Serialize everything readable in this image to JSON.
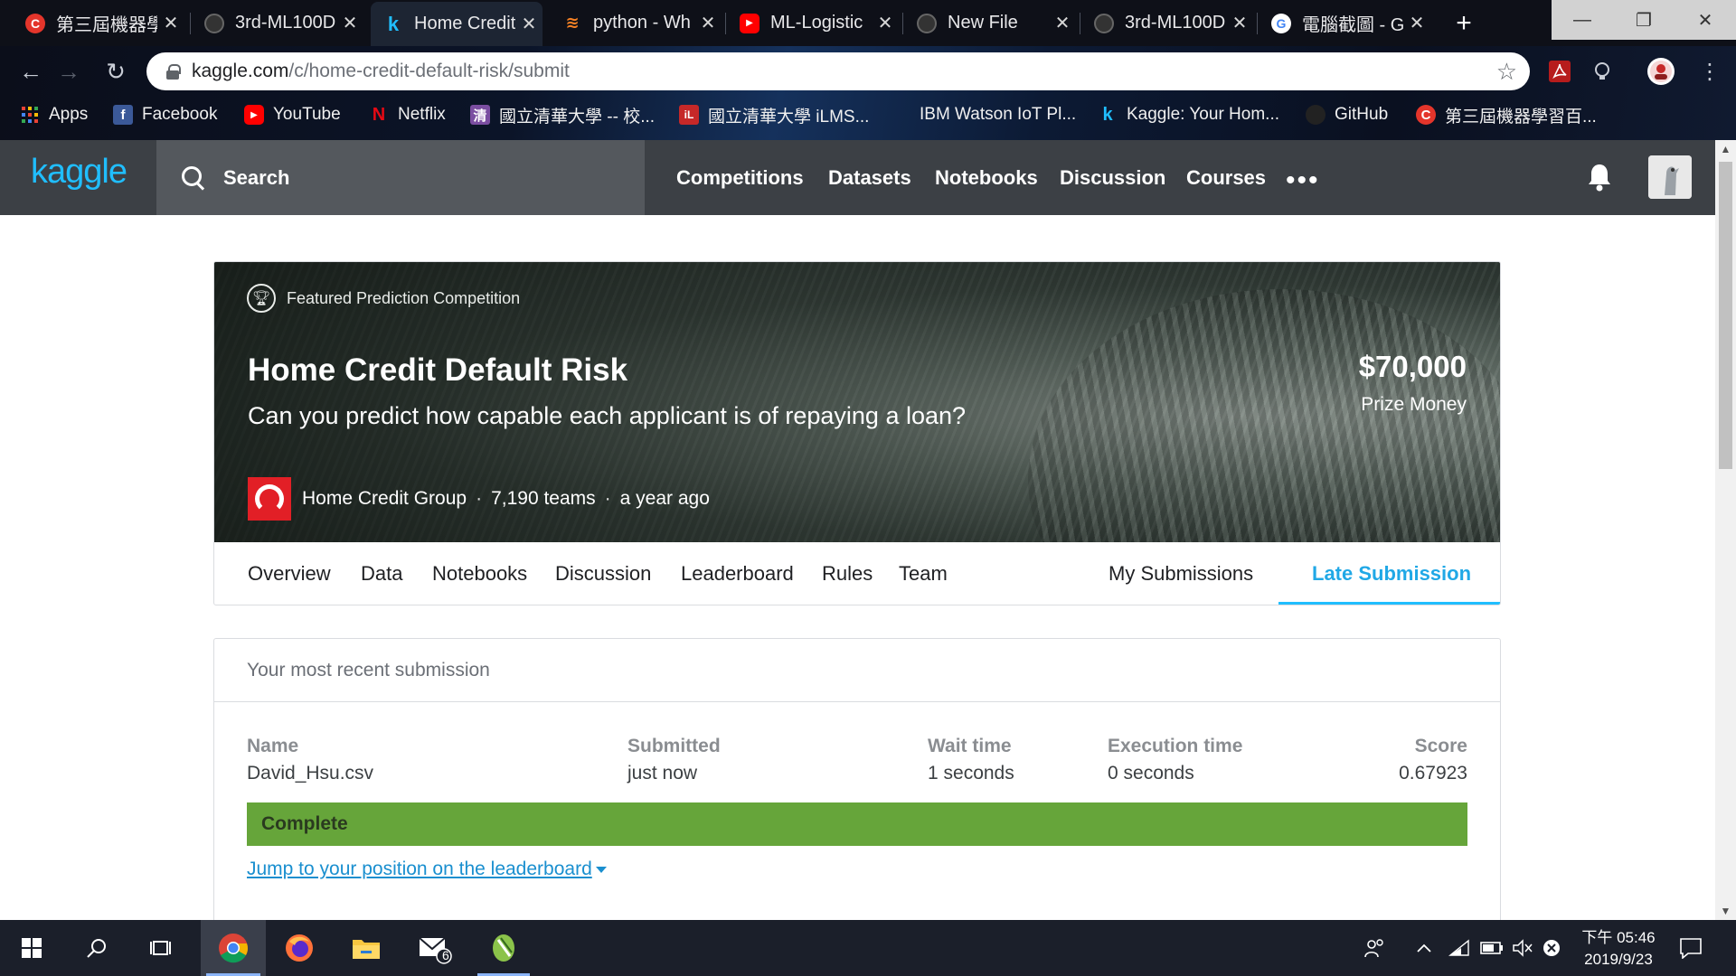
{
  "browser": {
    "tabs": [
      {
        "title": "第三屆機器學",
        "icon": "ml100-red-icon",
        "active": false
      },
      {
        "title": "3rd-ML100D",
        "icon": "github-icon",
        "active": false
      },
      {
        "title": "Home Credit",
        "icon": "kaggle-icon",
        "active": true
      },
      {
        "title": "python - Wh",
        "icon": "stackoverflow-icon",
        "active": false
      },
      {
        "title": "ML-Logistic",
        "icon": "youtube-icon",
        "active": false
      },
      {
        "title": "New File",
        "icon": "github-icon",
        "active": false
      },
      {
        "title": "3rd-ML100D",
        "icon": "github-icon",
        "active": false
      },
      {
        "title": "電腦截圖 - G",
        "icon": "google-icon",
        "active": false
      }
    ],
    "new_tab": "+",
    "url_host": "kaggle.com",
    "url_path": "/c/home-credit-default-risk/submit",
    "bookmarks": [
      {
        "label": "Apps",
        "icon": "apps-grid-icon"
      },
      {
        "label": "Facebook",
        "icon": "facebook-icon"
      },
      {
        "label": "YouTube",
        "icon": "youtube-icon"
      },
      {
        "label": "Netflix",
        "icon": "netflix-icon"
      },
      {
        "label": "國立清華大學 -- 校...",
        "icon": "nthu-icon"
      },
      {
        "label": "國立清華大學 iLMS...",
        "icon": "ilms-icon"
      },
      {
        "label": "IBM Watson IoT Pl...",
        "icon": "ibm-icon"
      },
      {
        "label": "Kaggle: Your Hom...",
        "icon": "kaggle-icon"
      },
      {
        "label": "GitHub",
        "icon": "github-icon"
      },
      {
        "label": "第三屆機器學習百...",
        "icon": "ml100-red-icon"
      }
    ]
  },
  "kaggle": {
    "logo": "kaggle",
    "search_label": "Search",
    "nav": [
      "Competitions",
      "Datasets",
      "Notebooks",
      "Discussion",
      "Courses"
    ],
    "more": "•••"
  },
  "competition": {
    "badge": "Featured Prediction Competition",
    "title": "Home Credit Default Risk",
    "subtitle": "Can you predict how capable each applicant is of repaying a loan?",
    "prize": "$70,000",
    "prize_label": "Prize Money",
    "host": "Home Credit Group",
    "sep": "·",
    "teams": "7,190 teams",
    "age": "a year ago",
    "tabs": [
      "Overview",
      "Data",
      "Notebooks",
      "Discussion",
      "Leaderboard",
      "Rules",
      "Team",
      "My Submissions",
      "Late Submission"
    ],
    "active_tab": "Late Submission"
  },
  "submission": {
    "heading": "Your most recent submission",
    "columns": {
      "name": "Name",
      "submitted": "Submitted",
      "wait": "Wait time",
      "exec": "Execution time",
      "score": "Score"
    },
    "values": {
      "name": "David_Hsu.csv",
      "submitted": "just now",
      "wait": "1 seconds",
      "exec": "0 seconds",
      "score": "0.67923"
    },
    "status": "Complete",
    "status_color": "#66a53a",
    "jump_link": "Jump to your position on the leaderboard"
  },
  "taskbar": {
    "clock_time": "下午 05:46",
    "clock_date": "2019/9/23",
    "mail_badge": "6"
  }
}
